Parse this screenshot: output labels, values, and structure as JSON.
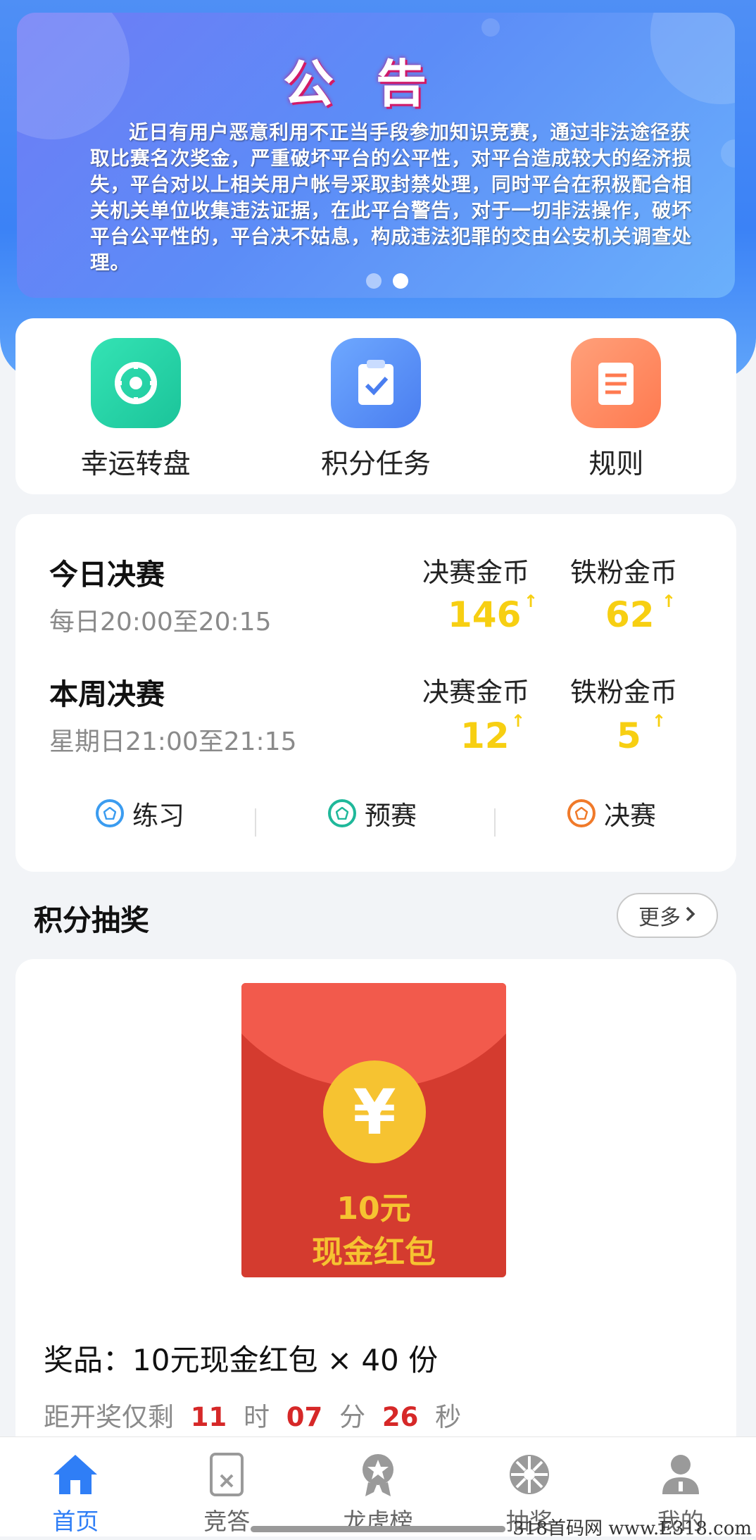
{
  "banner": {
    "title": "公告",
    "text": "近日有用户恶意利用不正当手段参加知识竞赛，通过非法途径获取比赛名次奖金，严重破坏平台的公平性，对平台造成较大的经济损失，平台对以上相关用户帐号采取封禁处理，同时平台在积极配合相关机关单位收集违法证据，在此平台警告，对于一切非法操作，破坏平台公平性的，平台决不姑息，构成违法犯罪的交由公安机关调查处理。",
    "active_dot": 2
  },
  "features": [
    {
      "label": "幸运转盘",
      "icon": "wheel-icon",
      "color": "#22d3a6"
    },
    {
      "label": "积分任务",
      "icon": "clipboard-check-icon",
      "color": "#5b8ff9"
    },
    {
      "label": "规则",
      "icon": "document-list-icon",
      "color": "#ff8a5b"
    }
  ],
  "finals": {
    "today": {
      "title": "今日决赛",
      "time": "每日20:00至20:15",
      "final_coins_label": "决赛金币",
      "final_coins": "146",
      "fan_coins_label": "铁粉金币",
      "fan_coins": "62"
    },
    "week": {
      "title": "本周决赛",
      "time": "星期日21:00至21:15",
      "final_coins_label": "决赛金币",
      "final_coins": "12",
      "fan_coins_label": "铁粉金币",
      "fan_coins": "5"
    },
    "arrow": "↑",
    "tabs": [
      {
        "label": "练习",
        "color": "#3b9cf0"
      },
      {
        "label": "预赛",
        "color": "#1fb89a"
      },
      {
        "label": "决赛",
        "color": "#f07a2a"
      }
    ]
  },
  "lottery": {
    "section_title": "积分抽奖",
    "more": "更多",
    "envelope": {
      "symbol": "¥",
      "line1": "10元",
      "line2": "现金红包"
    },
    "prize_text": "奖品：10元现金红包 × 40 份",
    "countdown": {
      "prefix": "距开奖仅剩",
      "hours": "11",
      "h_unit": "时",
      "minutes": "07",
      "m_unit": "分",
      "seconds": "26",
      "s_unit": "秒"
    }
  },
  "nav": [
    {
      "label": "首页",
      "icon": "home-icon",
      "active": true
    },
    {
      "label": "竞答",
      "icon": "quiz-card-icon",
      "active": false
    },
    {
      "label": "龙虎榜",
      "icon": "medal-icon",
      "active": false
    },
    {
      "label": "抽奖",
      "icon": "lottery-wheel-icon",
      "active": false
    },
    {
      "label": "我的",
      "icon": "profile-icon",
      "active": false
    }
  ],
  "watermark": "318首码网 www.E318.com",
  "colors": {
    "accent": "#2f7ef6",
    "coin": "#f7cf12",
    "countdown": "#d62828"
  }
}
